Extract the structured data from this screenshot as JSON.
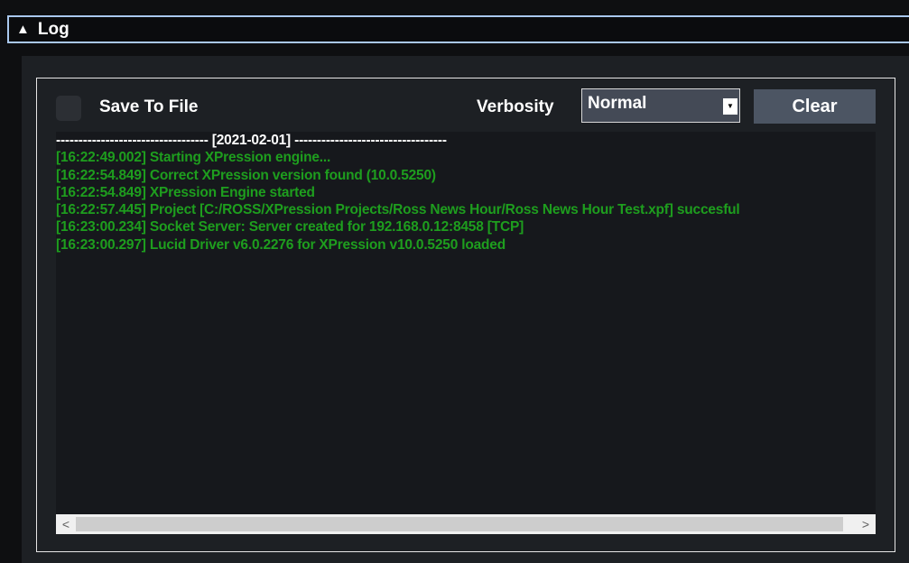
{
  "header": {
    "title": "Log",
    "collapse_glyph": "▲"
  },
  "toolbar": {
    "save_to_file_label": "Save To File",
    "save_to_file_checked": false,
    "verbosity_label": "Verbosity",
    "verbosity_value": "Normal",
    "clear_label": "Clear"
  },
  "log": {
    "date_line": "---------------------------------- [2021-02-01] ----------------------------------",
    "entries": [
      "[16:22:49.002] Starting XPression engine...",
      "[16:22:54.849] Correct XPression version found (10.0.5250)",
      "[16:22:54.849] XPression Engine started",
      "[16:22:57.445] Project [C:/ROSS/XPression Projects/Ross News Hour/Ross News Hour Test.xpf] succesful",
      "[16:23:00.234] Socket Server: Server created for 192.168.0.12:8458 [TCP]",
      "[16:23:00.297] Lucid Driver v6.0.2276 for XPression v10.0.5250  loaded"
    ]
  },
  "scrollbar": {
    "left_glyph": "<",
    "right_glyph": ">"
  },
  "colors": {
    "log_text": "#1e9e1e",
    "header_border": "#a9c8ee",
    "button_bg": "#4c5563"
  }
}
